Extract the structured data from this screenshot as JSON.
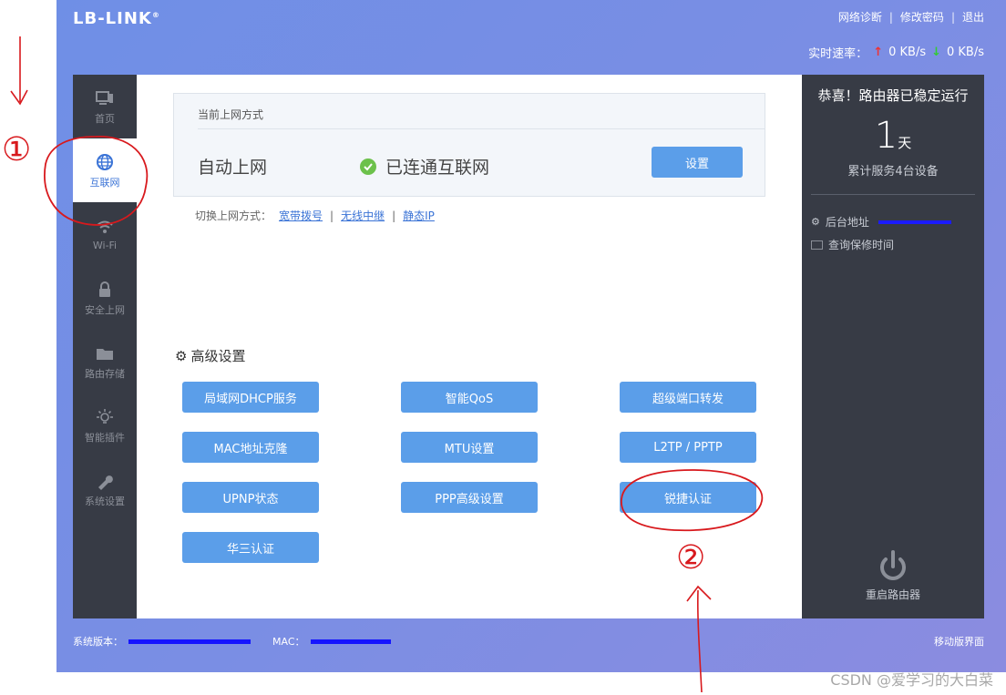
{
  "brand": {
    "logo_text": "LB-LINK",
    "logo_mark": "®"
  },
  "top_links": [
    "网络诊断",
    "修改密码",
    "退出"
  ],
  "speed": {
    "label": "实时速率：",
    "up": "0 KB/s",
    "down": "0 KB/s"
  },
  "sidebar": {
    "items": [
      {
        "label": "首页",
        "icon": "monitor-icon"
      },
      {
        "label": "互联网",
        "icon": "globe-icon"
      },
      {
        "label": "Wi-Fi",
        "icon": "wifi-icon"
      },
      {
        "label": "安全上网",
        "icon": "lock-icon"
      },
      {
        "label": "路由存储",
        "icon": "folder-icon"
      },
      {
        "label": "智能插件",
        "icon": "bulb-icon"
      },
      {
        "label": "系统设置",
        "icon": "wrench-icon"
      }
    ]
  },
  "internet": {
    "box_title": "当前上网方式",
    "mode": "自动上网",
    "status": "已连通互联网",
    "set_button": "设置",
    "switch_label": "切换上网方式：",
    "switch_links": [
      "宽带拨号",
      "无线中继",
      "静态IP"
    ],
    "separator": "|"
  },
  "advanced": {
    "title": "高级设置",
    "buttons": [
      "局域网DHCP服务",
      "智能QoS",
      "超级端口转发",
      "MAC地址克隆",
      "MTU设置",
      "L2TP / PPTP",
      "UPNP状态",
      "PPP高级设置",
      "锐捷认证",
      "华三认证"
    ]
  },
  "right_panel": {
    "title": "恭喜！路由器已稳定运行",
    "days_num": "1",
    "days_unit": "天",
    "service": "累计服务4台设备",
    "admin_label": "后台地址",
    "warranty_label": "查询保修时间",
    "reboot_label": "重启路由器"
  },
  "footer": {
    "version_label": "系统版本：",
    "mac_label": "MAC：",
    "mobile_link": "移动版界面"
  },
  "annotations": {
    "mark1": "①",
    "mark2": "②"
  },
  "watermark": "CSDN @爱学习的大白菜",
  "colors": {
    "accent": "#5b9ee9",
    "sidebar_bg": "#373b45",
    "ok_green": "#6cc14b"
  }
}
